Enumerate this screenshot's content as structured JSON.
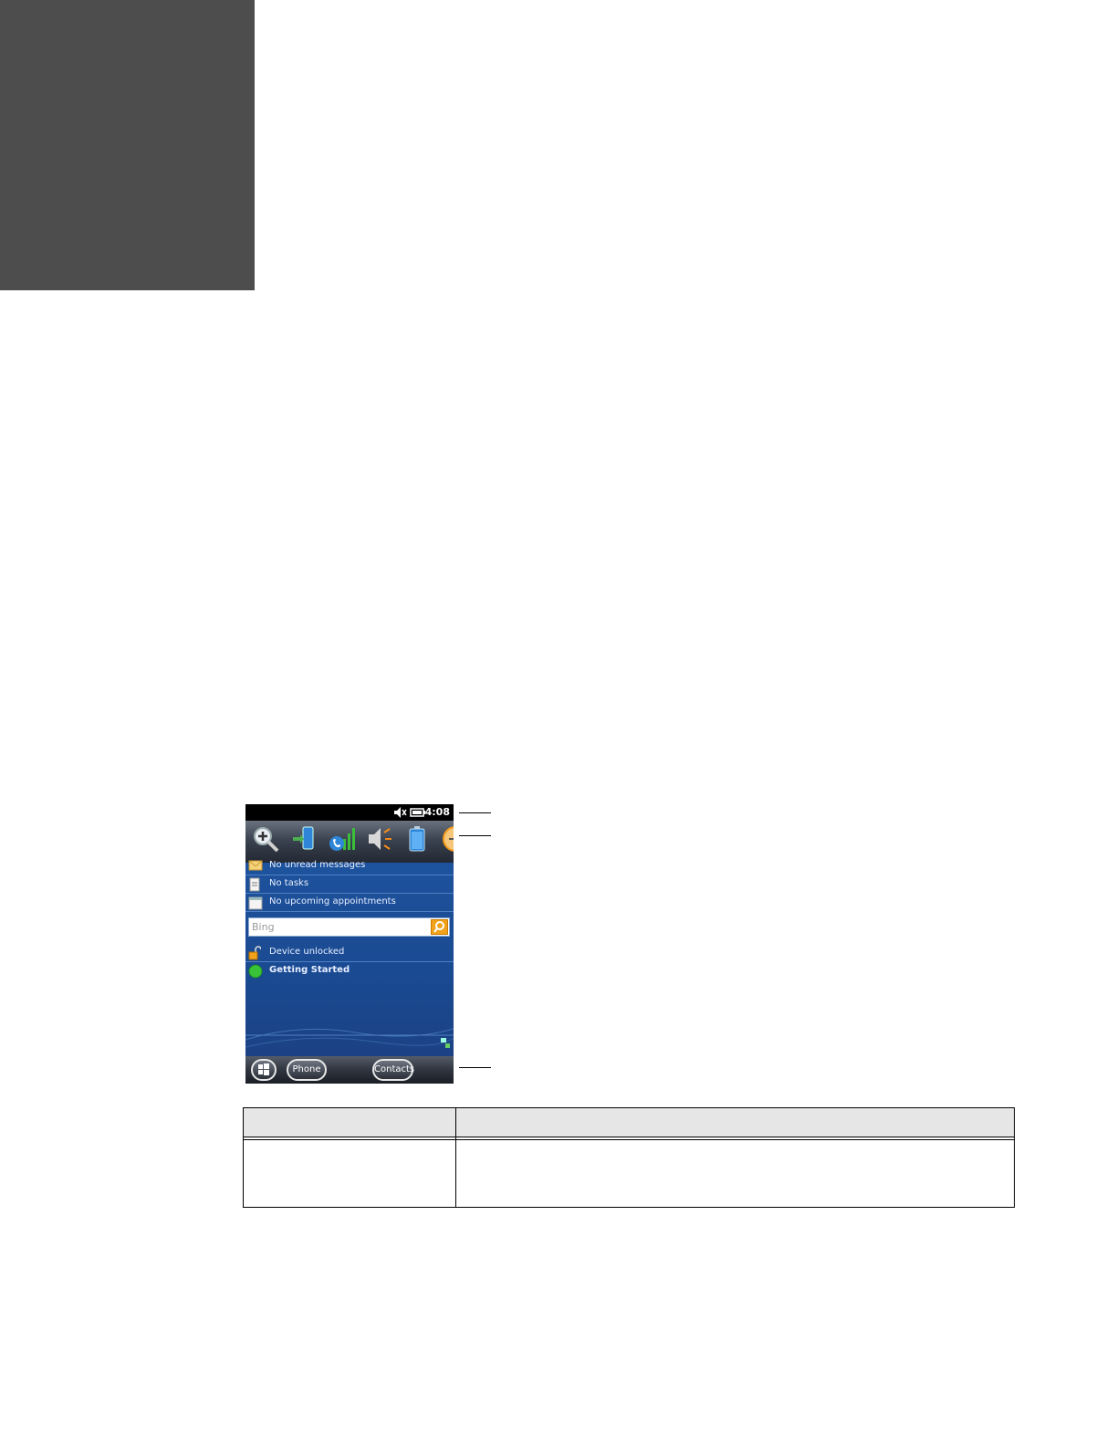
{
  "status_bar": {
    "time": "4:08"
  },
  "today_items": {
    "messages": "No unread messages",
    "tasks": "No tasks",
    "appointments": "No upcoming appointments",
    "lock": "Device unlocked",
    "getting_started": "Getting Started"
  },
  "search": {
    "placeholder": "Bing"
  },
  "taskbar": {
    "phone_label": "Phone",
    "contacts_label": "Contacts"
  },
  "colors": {
    "accent": "#f2a21a",
    "screen_blue": "#1c4f98",
    "dark_tab": "#4d4d4d"
  }
}
